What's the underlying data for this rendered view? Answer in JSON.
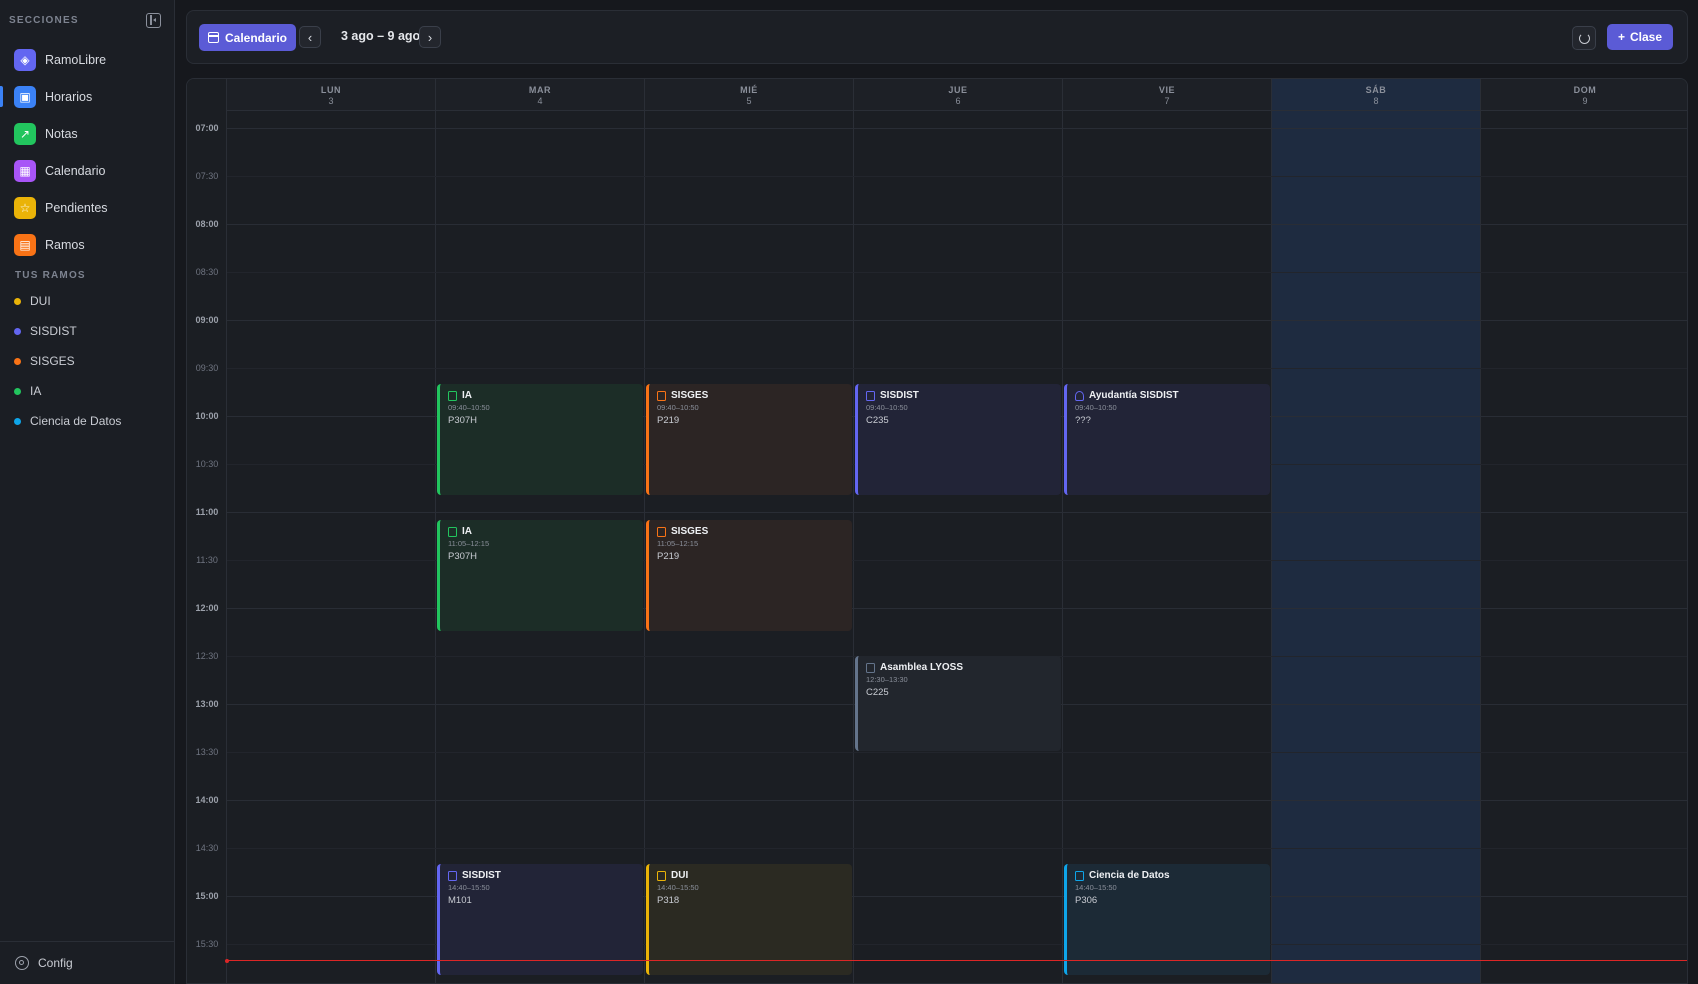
{
  "sidebar": {
    "section_title": "SECCIONES",
    "nav": [
      {
        "label": "RamoLibre",
        "icon": "graduation-cap-icon",
        "color": "#6366f1",
        "glyph": "◈"
      },
      {
        "label": "Horarios",
        "icon": "calendar-check-icon",
        "color": "#3b82f6",
        "glyph": "▣",
        "active": true
      },
      {
        "label": "Notas",
        "icon": "trending-up-icon",
        "color": "#22c55e",
        "glyph": "↗"
      },
      {
        "label": "Calendario",
        "icon": "calendar-icon",
        "color": "#a855f7",
        "glyph": "▦"
      },
      {
        "label": "Pendientes",
        "icon": "star-icon",
        "color": "#eab308",
        "glyph": "☆"
      },
      {
        "label": "Ramos",
        "icon": "book-icon",
        "color": "#f97316",
        "glyph": "▤"
      }
    ],
    "ramos_title": "TUS RAMOS",
    "ramos": [
      {
        "label": "DUI",
        "color": "#eab308"
      },
      {
        "label": "SISDIST",
        "color": "#6366f1"
      },
      {
        "label": "SISGES",
        "color": "#f97316"
      },
      {
        "label": "IA",
        "color": "#22c55e"
      },
      {
        "label": "Ciencia de Datos",
        "color": "#0ea5e9"
      }
    ],
    "config_label": "Config"
  },
  "toolbar": {
    "calendar_button": "Calendario",
    "range": "3 ago – 9 ago",
    "prev_glyph": "‹",
    "next_glyph": "›",
    "add_button": "Clase",
    "add_glyph": "+"
  },
  "calendar": {
    "days": [
      {
        "name": "LUN",
        "date": "3"
      },
      {
        "name": "MAR",
        "date": "4"
      },
      {
        "name": "MIÉ",
        "date": "5"
      },
      {
        "name": "JUE",
        "date": "6"
      },
      {
        "name": "VIE",
        "date": "7"
      },
      {
        "name": "SÁB",
        "date": "8",
        "today": true
      },
      {
        "name": "DOM",
        "date": "9"
      }
    ],
    "times": [
      "07:00",
      "07:30",
      "08:00",
      "08:30",
      "09:00",
      "09:30",
      "10:00",
      "10:30",
      "11:00",
      "11:30",
      "12:00",
      "12:30",
      "13:00",
      "13:30",
      "14:00",
      "14:30",
      "15:00",
      "15:30"
    ],
    "now": "15:40",
    "events": [
      {
        "day": 1,
        "title": "IA",
        "time": "09:40–10:50",
        "room": "P307H",
        "color": "#22c55e",
        "bg": "#1c2d27",
        "start": "09:40",
        "end": "10:50"
      },
      {
        "day": 2,
        "title": "SISGES",
        "time": "09:40–10:50",
        "room": "P219",
        "color": "#f97316",
        "bg": "#2c2524",
        "start": "09:40",
        "end": "10:50"
      },
      {
        "day": 3,
        "title": "SISDIST",
        "time": "09:40–10:50",
        "room": "C235",
        "color": "#6366f1",
        "bg": "#222437",
        "start": "09:40",
        "end": "10:50"
      },
      {
        "day": 4,
        "title": "Ayudantía SISDIST",
        "time": "09:40–10:50",
        "room": "???",
        "color": "#6366f1",
        "bg": "#222437",
        "start": "09:40",
        "end": "10:50",
        "icon": "user"
      },
      {
        "day": 1,
        "title": "IA",
        "time": "11:05–12:15",
        "room": "P307H",
        "color": "#22c55e",
        "bg": "#1c2d27",
        "start": "11:05",
        "end": "12:15"
      },
      {
        "day": 2,
        "title": "SISGES",
        "time": "11:05–12:15",
        "room": "P219",
        "color": "#f97316",
        "bg": "#2c2524",
        "start": "11:05",
        "end": "12:15"
      },
      {
        "day": 3,
        "title": "Asamblea LYOSS",
        "time": "12:30–13:30",
        "room": "C225",
        "color": "#64748b",
        "bg": "#22262d",
        "start": "12:30",
        "end": "13:30",
        "icon": "screen"
      },
      {
        "day": 1,
        "title": "SISDIST",
        "time": "14:40–15:50",
        "room": "M101",
        "color": "#6366f1",
        "bg": "#222437",
        "start": "14:40",
        "end": "15:50"
      },
      {
        "day": 2,
        "title": "DUI",
        "time": "14:40–15:50",
        "room": "P318",
        "color": "#eab308",
        "bg": "#2b2a22",
        "start": "14:40",
        "end": "15:50"
      },
      {
        "day": 4,
        "title": "Ciencia de Datos",
        "time": "14:40–15:50",
        "room": "P306",
        "color": "#0ea5e9",
        "bg": "#1c2a36",
        "start": "14:40",
        "end": "15:50"
      }
    ]
  }
}
